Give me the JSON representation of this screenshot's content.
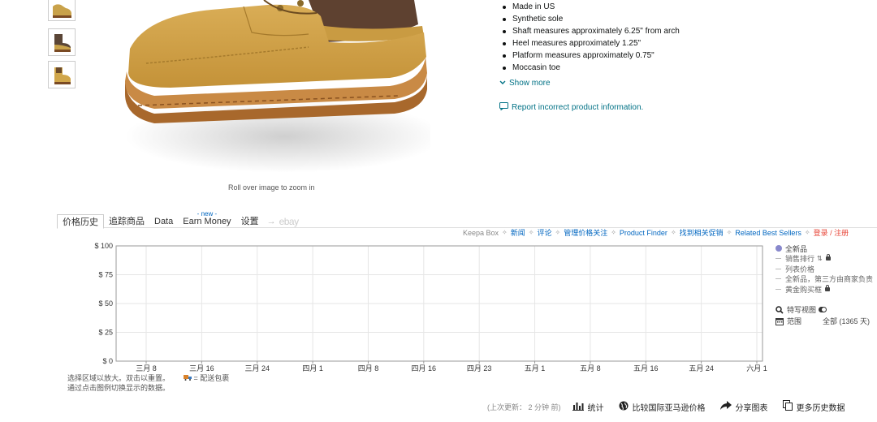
{
  "product": {
    "zoom_hint": "Roll over image to zoom in",
    "bullets": [
      "Made in US",
      "Synthetic sole",
      "Shaft measures approximately 6.25\" from arch",
      "Heel measures approximately 1.25\"",
      "Platform measures approximately 0.75\"",
      "Moccasin toe"
    ],
    "show_more": "Show more",
    "report": "Report incorrect product information."
  },
  "keepa": {
    "tabs": [
      "价格历史",
      "追踪商品",
      "Data",
      "Earn Money",
      "设置"
    ],
    "new_tag": "- new -",
    "ebay": "ebay",
    "links": {
      "box": "Keepa Box",
      "news": "新闻",
      "comments": "评论",
      "manage": "管理价格关注",
      "finder": "Product Finder",
      "deals": "找到相关促销",
      "related": "Related Best Sellers",
      "login": "登录 / 注册"
    },
    "legend": {
      "new": "全新品",
      "sales_rank": "销售排行",
      "list_price": "列表价格",
      "new_3p": "全新品，第三方由商家负责",
      "buy_box": "黄金购买框",
      "close_view": "特写视图",
      "range_label": "范围",
      "range_value": "全部 (1365 天)"
    },
    "note_line1": "选择区域以放大。双击以重置。",
    "note_ship": "= 配送包裹",
    "note_line2": "通过点击图例切换显示的数据。",
    "footer": {
      "updated": "(上次更新： 2 分钟 前)",
      "stats": "统计",
      "compare": "比较国际亚马逊价格",
      "share": "分享图表",
      "more": "更多历史数据"
    },
    "colors": {
      "new_series": "#8888cc",
      "link": "#0066c0",
      "login": "#e8473a"
    }
  },
  "chart_data": {
    "type": "line",
    "title": "",
    "xlabel": "",
    "ylabel": "",
    "y_ticks": [
      "$ 0",
      "$ 25",
      "$ 50",
      "$ 75",
      "$ 100"
    ],
    "ylim": [
      0,
      100
    ],
    "x_ticks": [
      "三月 8",
      "三月 16",
      "三月 24",
      "四月 1",
      "四月 8",
      "四月 16",
      "四月 23",
      "五月 1",
      "五月 8",
      "五月 16",
      "五月 24",
      "六月 1"
    ],
    "series": [],
    "grid": true
  }
}
